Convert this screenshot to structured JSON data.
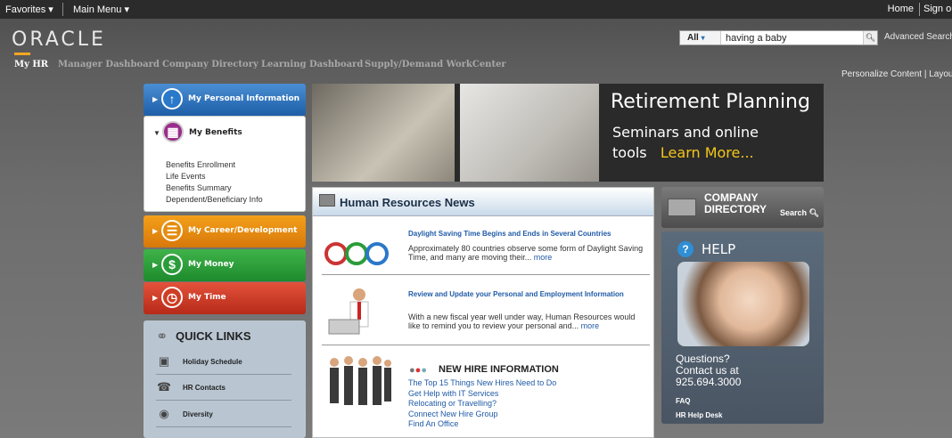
{
  "topbar": {
    "favorites": "Favorites ▾",
    "main_menu": "Main Menu ▾",
    "home": "Home",
    "sign_out": "Sign ou"
  },
  "logo": "ORACLE",
  "search": {
    "scope": "All",
    "scope_arrow": "▾",
    "value": "having a baby",
    "advanced": "Advanced Search"
  },
  "nav": [
    "My HR",
    "Manager Dashboard",
    "Company Directory",
    "Learning Dashboard",
    "Supply/Demand WorkCenter"
  ],
  "personalize": "Personalize Content | Layout",
  "left_panels": {
    "personal": "My Personal Information",
    "benefits": "My Benefits",
    "benefits_links": [
      "Benefits Enrollment",
      "Life Events",
      "Benefits Summary",
      "Dependent/Beneficiary Info"
    ],
    "career": "My Career/Development",
    "money": "My Money",
    "time": "My Time"
  },
  "quick_links": {
    "title": "QUICK LINKS",
    "items": [
      "Holiday Schedule",
      "HR Contacts",
      "Diversity"
    ]
  },
  "banner": {
    "title": "Retirement Planning",
    "line2": "Seminars and online",
    "line3a": "tools",
    "learn_more": "Learn More..."
  },
  "news": {
    "title": "Human Resources News",
    "items": [
      {
        "heading": "Daylight Saving Time Begins and Ends in Several Countries",
        "body": "Approximately 80 countries observe some form of Daylight Saving Time, and many are moving their...",
        "more": "more"
      },
      {
        "heading": "Review and Update your Personal and Employment Information",
        "body": "With a new fiscal year well under way, Human Resources would like to remind you to review your personal and...",
        "more": "more"
      }
    ],
    "new_hire_title": "NEW HIRE INFORMATION",
    "new_hire_links": [
      "The Top 15 Things New Hires Need to Do",
      "Get Help with IT Services",
      "Relocating or Travelling?",
      "Connect New Hire Group",
      "Find An Office"
    ]
  },
  "company_directory": {
    "line1": "COMPANY",
    "line2": "DIRECTORY",
    "search": "Search"
  },
  "help": {
    "title": "HELP",
    "q1": "Questions?",
    "q2": "Contact us at",
    "phone": "925.694.3000",
    "faq": "FAQ",
    "desk": "HR Help Desk"
  }
}
